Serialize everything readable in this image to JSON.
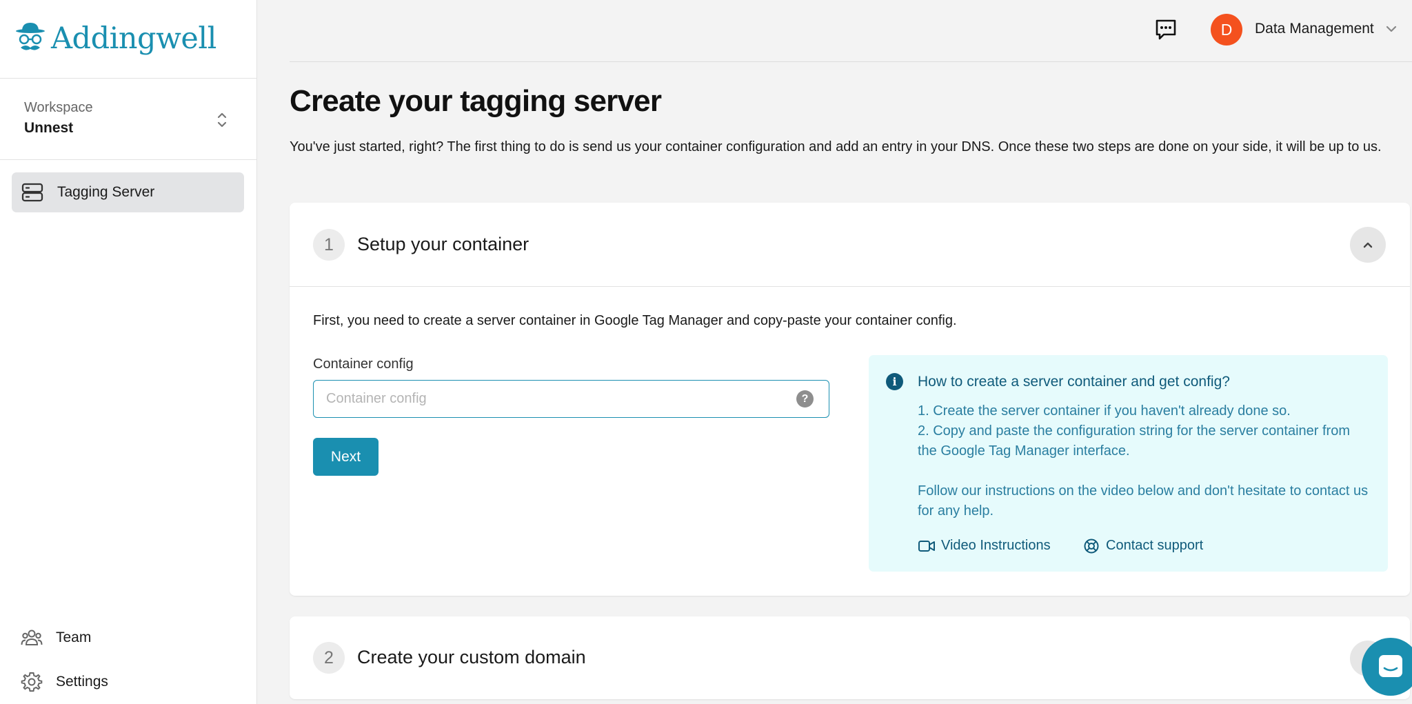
{
  "brand": {
    "name": "Addingwell",
    "color": "#1a8fb0"
  },
  "sidebar": {
    "workspace_label": "Workspace",
    "workspace_value": "Unnest",
    "items": [
      {
        "label": "Tagging Server",
        "icon": "server-icon",
        "active": true
      },
      {
        "label": "Team",
        "icon": "team-icon"
      },
      {
        "label": "Settings",
        "icon": "gear-icon"
      }
    ]
  },
  "header": {
    "user_initial": "D",
    "user_name": "Data Management",
    "avatar_color": "#f4511e"
  },
  "main": {
    "title": "Create your tagging server",
    "intro": "You've just started, right? The first thing to do is send us your container configuration and add an entry in your DNS. Once these two steps are done on your side, it will be up to us.",
    "step1": {
      "number": "1",
      "title": "Setup your container",
      "description": "First, you need to create a server container in Google Tag Manager and copy-paste your container config.",
      "field_label": "Container config",
      "field_placeholder": "Container config",
      "field_value": "",
      "next_label": "Next",
      "info": {
        "title": "How to create a server container and get config?",
        "line1": "1. Create the server container if you haven't already done so.",
        "line2": "2. Copy and paste the configuration string for the server container from the Google Tag Manager interface.",
        "line3": "Follow our instructions on the video below and don't hesitate to contact us for any help.",
        "video_link": "Video Instructions",
        "support_link": "Contact support"
      }
    },
    "step2": {
      "number": "2",
      "title": "Create your custom domain"
    }
  }
}
